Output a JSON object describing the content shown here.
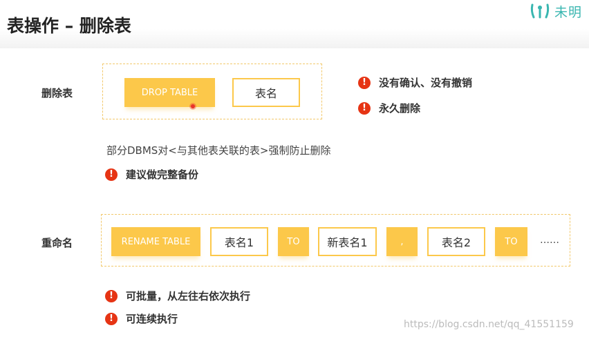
{
  "header": {
    "title": "表操作 – 删除表"
  },
  "brand": {
    "name": "未明"
  },
  "drop": {
    "label": "删除表",
    "command": "DROP TABLE",
    "param": "表名",
    "notes": [
      "没有确认、没有撤销",
      "永久删除"
    ],
    "constraint": "部分DBMS对<与其他表关联的表>强制防止删除",
    "advice": "建议做完整备份"
  },
  "rename": {
    "label": "重命名",
    "command": "RENAME TABLE",
    "old1": "表名1",
    "to": "TO",
    "new1": "新表名1",
    "comma": ",",
    "old2": "表名2",
    "ellipsis": "……",
    "notes": [
      "可批量，从左往右依次执行",
      "可连续执行"
    ]
  },
  "watermark": "https://blog.csdn.net/qq_41551159",
  "icons": {
    "warning": "!"
  }
}
